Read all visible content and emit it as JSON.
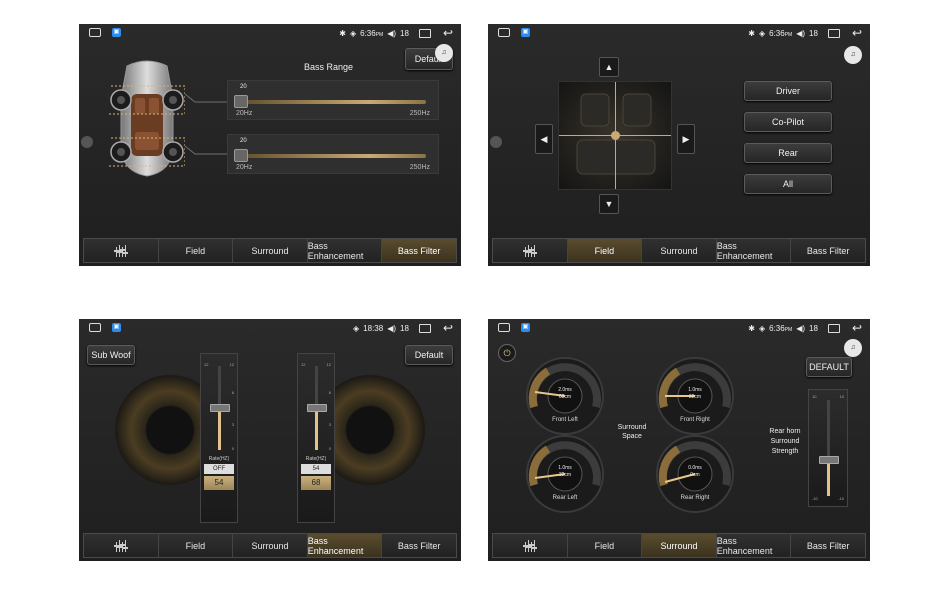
{
  "status": {
    "time_a": "6:36",
    "ampm": "PM",
    "volume": "18",
    "time_b": "18:38"
  },
  "tabs": [
    "Field",
    "Surround",
    "Bass Enhancement",
    "Bass Filter"
  ],
  "screen1": {
    "default_label": "Default",
    "title": "Bass Range",
    "slider1": {
      "value": "20",
      "min": "20Hz",
      "max": "250Hz",
      "level": 0.0
    },
    "slider2": {
      "value": "20",
      "min": "20Hz",
      "max": "250Hz",
      "level": 0.0
    }
  },
  "screen2": {
    "buttons": [
      "Driver",
      "Co-Pilot",
      "Rear",
      "All"
    ],
    "arrow_up": "▲",
    "arrow_down": "▼",
    "arrow_left": "◀",
    "arrow_right": "▶"
  },
  "screen3": {
    "subwoof_label": "Sub Woof",
    "default_label": "Default",
    "left": {
      "scale_top": "12",
      "scale_mid": "6",
      "scale_3": "3",
      "scale_0": "0",
      "rate": "Rate(HZ)",
      "box": "OFF",
      "freq": "54",
      "level": 0.5
    },
    "right": {
      "scale_top": "12",
      "scale_mid": "6",
      "scale_3": "3",
      "scale_0": "0",
      "rate": "Rate(HZ)",
      "box": "54",
      "freq": "68",
      "level": 0.5
    }
  },
  "screen4": {
    "default_label": "DEFAULT",
    "surround_space": "Surround Space",
    "rear_horn": "Rear horn Surround Strength",
    "gauges": [
      {
        "label": "Front Left",
        "line1": "2.0ms",
        "line2": "68cm"
      },
      {
        "label": "Front Right",
        "line1": "1.0ms",
        "line2": "32cm"
      },
      {
        "label": "Rear Left",
        "line1": "1.0ms",
        "line2": "32cm"
      },
      {
        "label": "Rear Right",
        "line1": "0.0ms",
        "line2": "0cm"
      }
    ],
    "strength_scale_top": "10",
    "strength_scale_bottom": "-10"
  },
  "colors": {
    "accent": "#c9aa72",
    "bg": "#232323",
    "active_tab": "#4d4127"
  },
  "icons": [
    "home-icon",
    "app-icon",
    "bluetooth-icon",
    "volume-icon",
    "window-icon",
    "back-icon",
    "equalizer-icon",
    "power-icon",
    "sound-effect-icon"
  ]
}
